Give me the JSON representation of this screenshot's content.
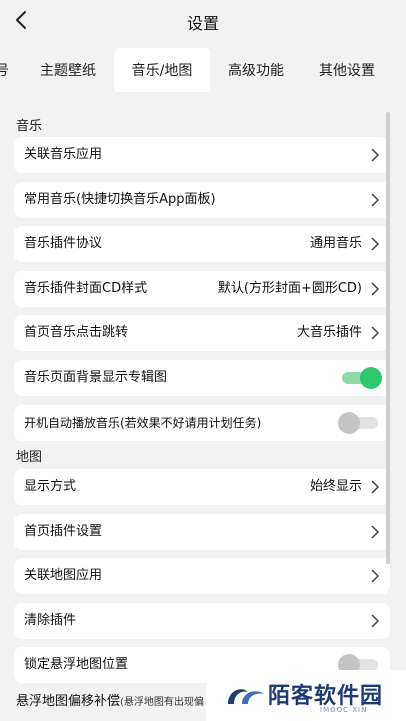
{
  "header": {
    "title": "设置",
    "back_icon": "chevron-left-icon"
  },
  "tabs": [
    {
      "label": "号",
      "active": false
    },
    {
      "label": "主题壁纸",
      "active": false
    },
    {
      "label": "音乐/地图",
      "active": true
    },
    {
      "label": "高级功能",
      "active": false
    },
    {
      "label": "其他设置",
      "active": false
    }
  ],
  "music": {
    "section_title": "音乐",
    "items": [
      {
        "label": "关联音乐应用",
        "value": ""
      },
      {
        "label": "常用音乐(快捷切换音乐App面板)",
        "value": ""
      },
      {
        "label": "音乐插件协议",
        "value": "通用音乐"
      },
      {
        "label": "音乐插件封面CD样式",
        "value": "默认(方形封面+圆形CD)"
      },
      {
        "label": "首页音乐点击跳转",
        "value": "大音乐插件"
      },
      {
        "label": "音乐页面背景显示专辑图",
        "toggle": true
      },
      {
        "label": "开机自动播放音乐(若效果不好请用计划任务)",
        "toggle": false
      }
    ]
  },
  "map": {
    "section_title": "地图",
    "items": [
      {
        "label": "显示方式",
        "value": "始终显示"
      },
      {
        "label": "首页插件设置",
        "value": ""
      },
      {
        "label": "关联地图应用",
        "value": ""
      },
      {
        "label": "清除插件",
        "value": ""
      },
      {
        "label": "锁定悬浮地图位置",
        "toggle": false
      }
    ],
    "partial_label": "悬浮地图偏移补偿",
    "partial_note": "(悬浮地图有出现偏"
  },
  "watermark": {
    "text": "陌客软件园",
    "sub": "IMOOC XIN"
  },
  "colors": {
    "accent_green": "#2dc76d",
    "page_bg": "#f2f2f2"
  }
}
